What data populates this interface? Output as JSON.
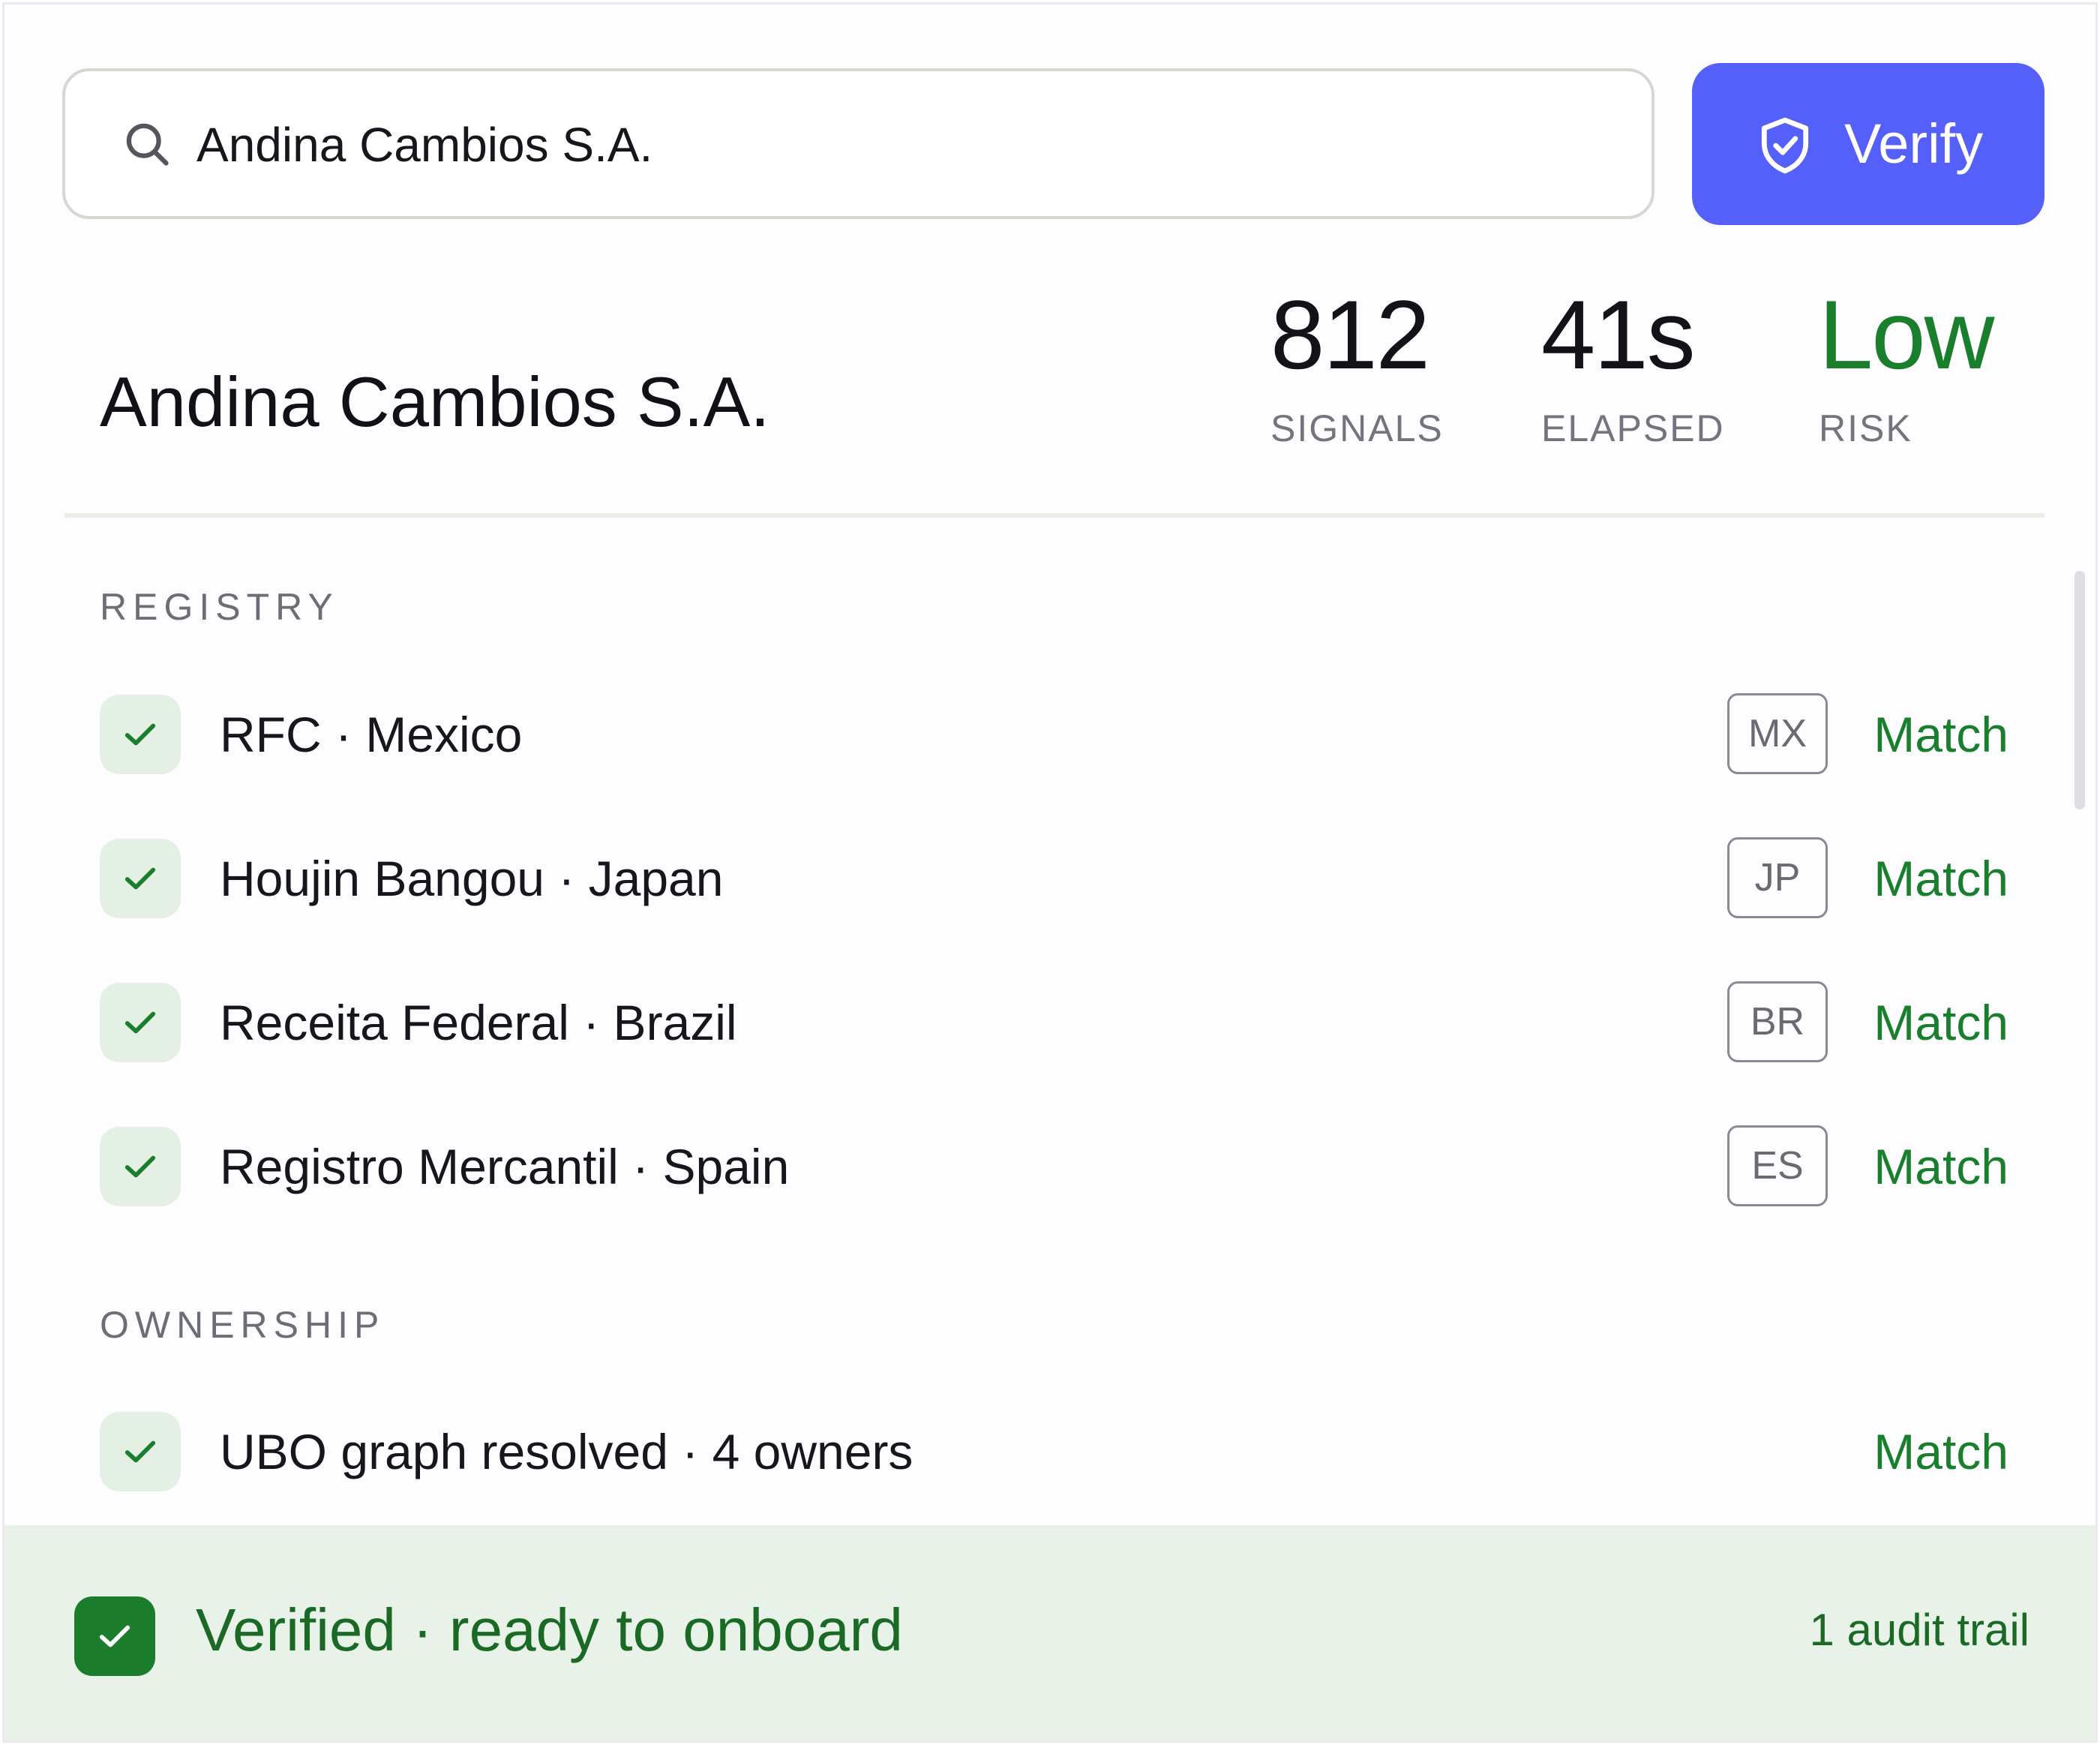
{
  "search": {
    "value": "Andina Cambios S.A.",
    "icon": "search-icon"
  },
  "verify_button": {
    "label": "Verify",
    "icon": "shield-check-icon",
    "color": "#5560fa"
  },
  "entity": {
    "title": "Andina Cambios S.A."
  },
  "stats": [
    {
      "value": "812",
      "label": "SIGNALS"
    },
    {
      "value": "41s",
      "label": "ELAPSED"
    },
    {
      "value": "Low",
      "label": "RISK",
      "color": "#1a7f2c"
    }
  ],
  "sections": {
    "registry": {
      "label": "REGISTRY",
      "rows": [
        {
          "label": "RFC · Mexico",
          "country": "MX",
          "status": "Match"
        },
        {
          "label": "Houjin Bangou · Japan",
          "country": "JP",
          "status": "Match"
        },
        {
          "label": "Receita Federal · Brazil",
          "country": "BR",
          "status": "Match"
        },
        {
          "label": "Registro Mercantil · Spain",
          "country": "ES",
          "status": "Match"
        }
      ]
    },
    "ownership": {
      "label": "OWNERSHIP",
      "rows": [
        {
          "label": "UBO graph resolved · 4 owners",
          "status": "Match"
        }
      ]
    }
  },
  "footer": {
    "text": "Verified · ready to onboard",
    "link": "1 audit trail",
    "icon": "check-icon",
    "accent": "#1b7d2c"
  },
  "colors": {
    "match": "#1a7f2c",
    "check_bg": "#e5f0e5",
    "footer_bg": "#e8f2e8"
  }
}
